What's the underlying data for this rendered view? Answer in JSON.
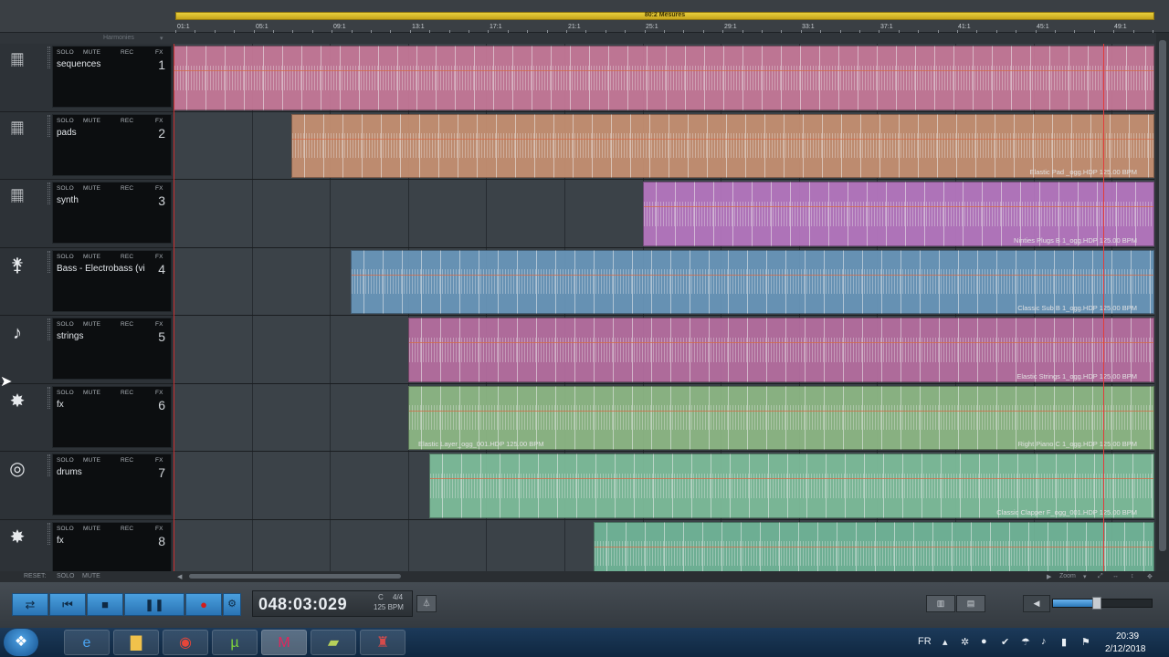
{
  "ruler": {
    "loop_label": "80:2 Mesures",
    "marks": [
      "01:1",
      "05:1",
      "09:1",
      "13:1",
      "17:1",
      "21:1",
      "25:1",
      "29:1",
      "33:1",
      "37:1",
      "41:1",
      "45:1",
      "49:1"
    ],
    "harmonies_label": "Harmonies"
  },
  "track_buttons": {
    "solo": "SOLO",
    "mute": "MUTE",
    "rec": "REC",
    "fx": "FX"
  },
  "tracks": [
    {
      "name": "sequences",
      "number": "1",
      "icon": "keyboard-icon",
      "color": "#c97a9a"
    },
    {
      "name": "pads",
      "number": "2",
      "icon": "keyboard-icon",
      "color": "#c99273"
    },
    {
      "name": "synth",
      "number": "3",
      "icon": "keyboard-icon",
      "color": "#b878c2"
    },
    {
      "name": "Bass - Electrobass (vi",
      "number": "4",
      "icon": "bass-guitar-icon",
      "color": "#6a98bd"
    },
    {
      "name": "strings",
      "number": "5",
      "icon": "violin-icon",
      "color": "#b86fa2"
    },
    {
      "name": "fx",
      "number": "6",
      "icon": "explosion-icon",
      "color": "#8fba86"
    },
    {
      "name": "drums",
      "number": "7",
      "icon": "drums-icon",
      "color": "#7fbf9c"
    },
    {
      "name": "fx",
      "number": "8",
      "icon": "explosion-icon",
      "color": "#72b89a"
    }
  ],
  "clips": {
    "pads": "Elastic Pad _ogg.HDP  125.00 BPM",
    "synth": "Ninties Plugs B 1_ogg.HDP  125.00 BPM",
    "bass": "Classic Sub B 1_ogg.HDP  125.00 BPM",
    "strings": "Elastic Strings 1_ogg.HDP  125.00 BPM",
    "fx_a": "Elastic Layer_ogg_001.HDP  125.00 BPM",
    "fx_b": "Right Piano C 1_ogg.HDP  125.00 BPM",
    "drums": "Classic Clapper F_ogg_001.HDP  125.00 BPM"
  },
  "bottom": {
    "reset": "RESET:",
    "solo": "SOLO",
    "mute": "MUTE",
    "zoom": "Zoom"
  },
  "transport": {
    "time": "048:03:029",
    "key": "C",
    "meter": "4/4",
    "bpm": "125 BPM"
  },
  "taskbar": {
    "lang": "FR",
    "time": "20:39",
    "date": "2/12/2018"
  },
  "colors": {
    "accent": "#3b8fd4",
    "playhead": "#e23b3b",
    "loop": "#e0c234"
  }
}
